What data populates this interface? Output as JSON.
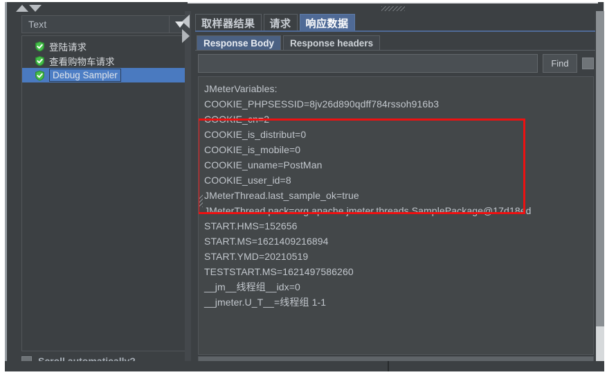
{
  "window": {
    "splitter_grip": "split-pane-grip"
  },
  "left_panel": {
    "sort_up_icon": "triangle-up-icon",
    "sort_down_icon": "triangle-down-icon",
    "format_combo": {
      "value": "Text",
      "arrow_icon": "chevron-down-icon"
    },
    "tree": {
      "items": [
        {
          "label": "登陆请求",
          "icon": "green-shield-check-icon",
          "selected": false
        },
        {
          "label": "查看购物车请求",
          "icon": "green-shield-check-icon",
          "selected": false
        },
        {
          "label": "Debug Sampler",
          "icon": "green-shield-check-icon",
          "selected": true
        }
      ]
    },
    "scroll_automatically": {
      "label": "Scroll automatically?",
      "checked": false
    }
  },
  "splitter": {
    "collapse_left_icon": "triangle-left-icon",
    "collapse_right_icon": "triangle-right-icon"
  },
  "right_panel": {
    "tabs": [
      {
        "label": "取样器结果",
        "active": false
      },
      {
        "label": "请求",
        "active": false
      },
      {
        "label": "响应数据",
        "active": true
      }
    ],
    "subtabs": [
      {
        "label": "Response Body",
        "active": true
      },
      {
        "label": "Response headers",
        "active": false
      }
    ],
    "find_bar": {
      "input_value": "",
      "placeholder": "",
      "button_label": "Find",
      "case_checkbox_checked": false
    },
    "response_body": {
      "lines": [
        "JMeterVariables:",
        "COOKIE_PHPSESSID=8jv26d890qdff784rssoh916b3",
        "COOKIE_cn=2",
        "COOKIE_is_distribut=0",
        "COOKIE_is_mobile=0",
        "COOKIE_uname=PostMan",
        "COOKIE_user_id=8",
        "JMeterThread.last_sample_ok=true",
        "JMeterThread.pack=org.apache.jmeter.threads.SamplePackage@17d18ed",
        "START.HMS=152656",
        "START.MS=1621409216894",
        "START.YMD=20210519",
        "TESTSTART.MS=1621497586260",
        "__jm__线程组__idx=0",
        "__jmeter.U_T__=线程组 1-1"
      ]
    },
    "annotation": {
      "type": "red-rectangle-highlight",
      "color": "#ee1111",
      "covers_lines": [
        "COOKIE_PHPSESSID=8jv26d890qdff784rssoh916b3",
        "COOKIE_cn=2",
        "COOKIE_is_distribut=0",
        "COOKIE_is_mobile=0",
        "COOKIE_uname=PostMan",
        "COOKIE_user_id=8"
      ]
    }
  },
  "colors": {
    "panel_bg": "#3c4043",
    "text_area_bg": "#434749",
    "selection_blue": "#4a7ac0",
    "active_tab_blue": "#4f6a96",
    "text_primary": "#c2c7cd",
    "annotation_red": "#ee1111",
    "shield_green": "#3aa33a"
  }
}
